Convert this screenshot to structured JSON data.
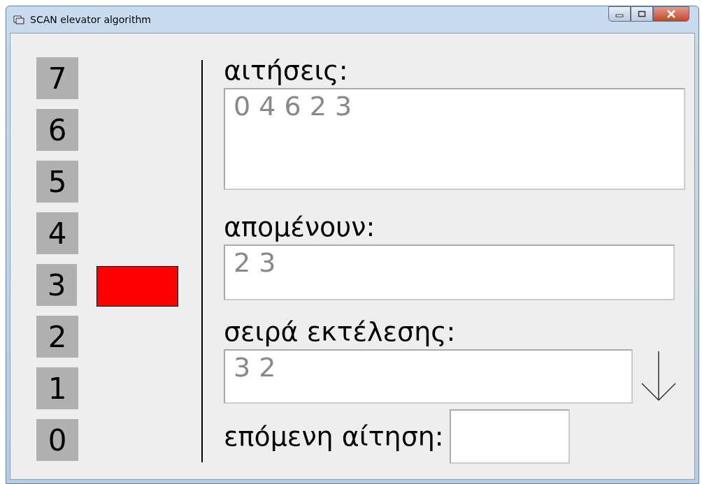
{
  "window": {
    "title": "SCAN elevator algorithm"
  },
  "floors": [
    {
      "label": "7",
      "car": false
    },
    {
      "label": "6",
      "car": false
    },
    {
      "label": "5",
      "car": false
    },
    {
      "label": "4",
      "car": false
    },
    {
      "label": "3",
      "car": true
    },
    {
      "label": "2",
      "car": false
    },
    {
      "label": "1",
      "car": false
    },
    {
      "label": "0",
      "car": false
    }
  ],
  "requests": {
    "label": "αιτήσεις:",
    "value": "0 4 6 2 3"
  },
  "remaining": {
    "label": "απομένουν:",
    "value": "2 3"
  },
  "execution_order": {
    "label": "σειρά εκτέλεσης:",
    "value": "3 2",
    "moving_down": true
  },
  "next_request": {
    "label": "επόμενη αίτηση:"
  }
}
